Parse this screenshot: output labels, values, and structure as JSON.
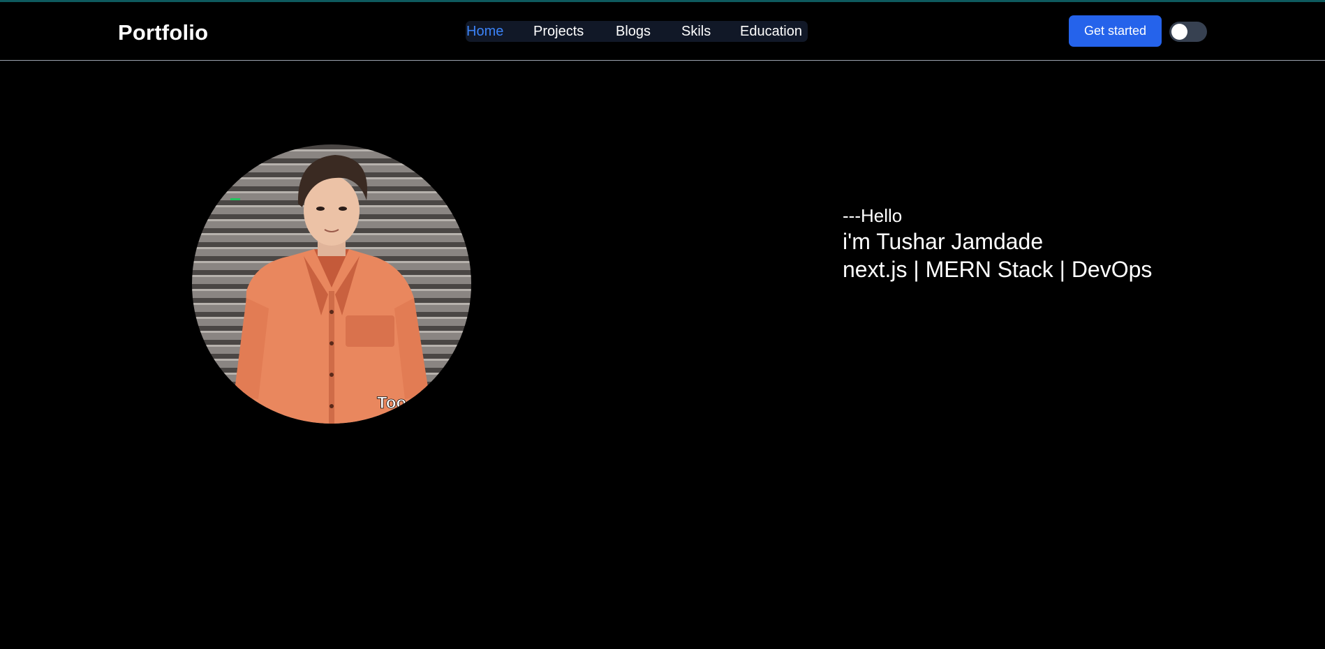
{
  "brand": {
    "title": "Portfolio"
  },
  "nav": {
    "items": [
      {
        "label": "Home",
        "active": true
      },
      {
        "label": "Projects",
        "active": false
      },
      {
        "label": "Blogs",
        "active": false
      },
      {
        "label": "Skils",
        "active": false
      },
      {
        "label": "Education",
        "active": false
      }
    ]
  },
  "header": {
    "cta_label": "Get started",
    "theme_toggle": {
      "state": "off"
    }
  },
  "hero": {
    "greeting": "---Hello",
    "name_line": "i'm Tushar Jamdade",
    "stack_line": "next.js | MERN Stack | DevOps",
    "avatar_caption": "Too"
  },
  "colors": {
    "background": "#000000",
    "accent": "#3b82f6",
    "button": "#2563eb",
    "nav_bg": "#111827",
    "top_accent": "#0e5a5e"
  }
}
